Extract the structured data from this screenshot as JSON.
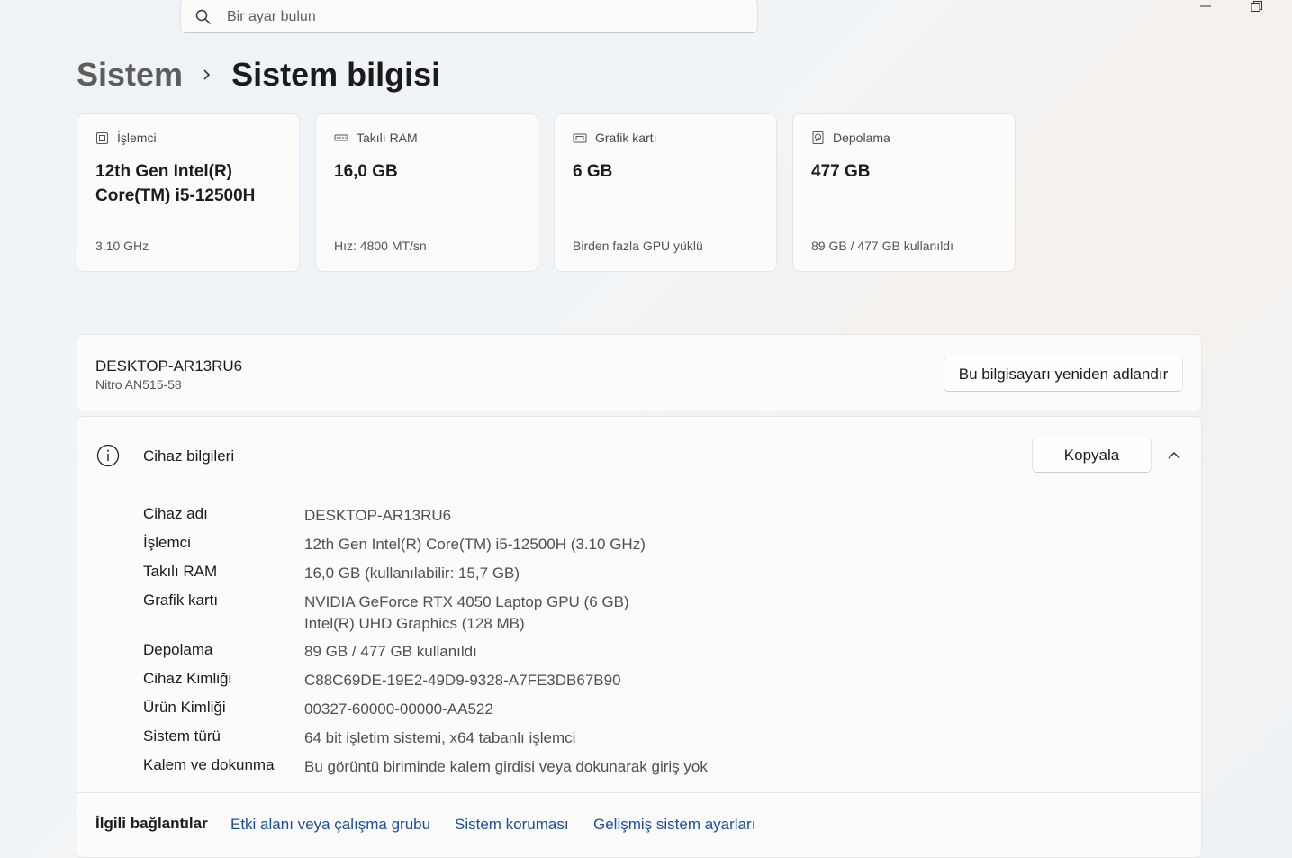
{
  "search": {
    "placeholder": "Bir ayar bulun"
  },
  "window": {
    "minimize_icon": "minimize-icon",
    "restore_icon": "restore-icon"
  },
  "breadcrumb": {
    "parent": "Sistem",
    "current": "Sistem bilgisi"
  },
  "cards": [
    {
      "icon": "processor-icon",
      "title": "İşlemci",
      "value": "12th Gen Intel(R) Core(TM) i5-12500H",
      "sub": "3.10 GHz"
    },
    {
      "icon": "ram-icon",
      "title": "Takılı RAM",
      "value": "16,0 GB",
      "sub": "Hız: 4800 MT/sn"
    },
    {
      "icon": "graphics-card-icon",
      "title": "Grafik kartı",
      "value": "6 GB",
      "sub": "Birden fazla GPU yüklü"
    },
    {
      "icon": "storage-icon",
      "title": "Depolama",
      "value": "477 GB",
      "sub": "89 GB / 477 GB kullanıldı"
    }
  ],
  "device": {
    "name": "DESKTOP-AR13RU6",
    "model": "Nitro AN515-58",
    "rename_label": "Bu bilgisayarı yeniden adlandır"
  },
  "device_info": {
    "title": "Cihaz bilgileri",
    "copy_label": "Kopyala",
    "rows": [
      {
        "label": "Cihaz adı",
        "value": "DESKTOP-AR13RU6"
      },
      {
        "label": "İşlemci",
        "value": "12th Gen Intel(R) Core(TM) i5-12500H (3.10 GHz)"
      },
      {
        "label": "Takılı RAM",
        "value": "16,0 GB (kullanılabilir: 15,7 GB)"
      },
      {
        "label": "Grafik kartı",
        "value": "NVIDIA GeForce RTX 4050 Laptop GPU (6 GB)",
        "value2": "Intel(R) UHD Graphics (128 MB)"
      },
      {
        "label": "Depolama",
        "value": "89 GB / 477 GB kullanıldı"
      },
      {
        "label": "Cihaz Kimliği",
        "value": "C88C69DE-19E2-49D9-9328-A7FE3DB67B90"
      },
      {
        "label": "Ürün Kimliği",
        "value": "00327-60000-00000-AA522"
      },
      {
        "label": "Sistem türü",
        "value": "64 bit işletim sistemi, x64 tabanlı işlemci"
      },
      {
        "label": "Kalem ve dokunma",
        "value": "Bu görüntü biriminde kalem girdisi veya dokunarak giriş yok"
      }
    ]
  },
  "related": {
    "title": "İlgili bağlantılar",
    "links": [
      "Etki alanı veya çalışma grubu",
      "Sistem koruması",
      "Gelişmiş sistem ayarları"
    ]
  },
  "colors": {
    "link": "#1a4ea3",
    "accent": "#005fb8"
  }
}
